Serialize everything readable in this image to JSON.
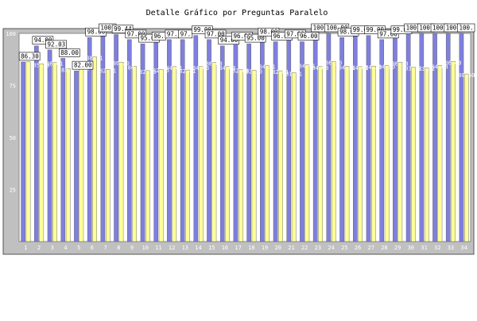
{
  "chart_data": {
    "type": "bar",
    "title": "Detalle Gráfico por Preguntas Paralelo",
    "ylim": [
      0,
      100
    ],
    "y_ticks": [
      "25",
      "50",
      "75",
      "100"
    ],
    "grid": false,
    "legend": "none",
    "categories": [
      "1",
      "2",
      "3",
      "4",
      "5",
      "6",
      "7",
      "8",
      "9",
      "10",
      "11",
      "12",
      "13",
      "14",
      "15",
      "16",
      "17",
      "18",
      "19",
      "20",
      "21",
      "22",
      "23",
      "24",
      "25",
      "26",
      "27",
      "28",
      "29",
      "30",
      "31",
      "32",
      "33",
      "34"
    ],
    "series": [
      {
        "color": "#7f7fdf",
        "values": [
          86.3,
          94,
          92.03,
          88,
          82,
          98,
          100,
          99.44,
          97,
          95,
          96,
          97,
          97,
          99,
          97,
          94,
          96,
          95,
          98,
          96,
          97,
          96,
          100,
          100,
          98,
          99,
          99,
          97,
          99,
          100,
          100,
          100,
          100,
          100
        ],
        "labels": [
          "86.30",
          "94.00",
          "92.03",
          "88.00",
          "82.00",
          "98.00",
          "100.",
          "99.44",
          "97.00",
          "95.00",
          "96.",
          "97.",
          "97.",
          "99.00",
          "97.00",
          "94.00",
          "96.00",
          "95.00",
          "98.00",
          "96.00",
          "97.00",
          "96.00",
          "100.",
          "100.00",
          "98.00",
          "99.0",
          "99.00",
          "97.00",
          "99.00",
          "100.",
          "100.",
          "100.",
          "100.",
          "100."
        ]
      },
      {
        "color": "#ffff99",
        "values": [
          86.3,
          85.36,
          86.01,
          83.1,
          83.82,
          88.71,
          82.71,
          86.2,
          84.1,
          82.1,
          82.75,
          84.01,
          82.41,
          84.03,
          86.03,
          84.03,
          82.68,
          82.3,
          84.51,
          82.01,
          81.11,
          84.91,
          84.03,
          86.5,
          84.21,
          84.01,
          84.3,
          84.5,
          86.13,
          83.72,
          83.52,
          84.63,
          86.48,
          80.5
        ],
        "labels": [
          "",
          "85.36",
          "86.01",
          "83.1",
          "83.82",
          "88.71",
          "82.71",
          "86.20",
          "84.1",
          "82.10",
          "82.75",
          "84.01",
          "82.41",
          "84.03",
          "86.03",
          "84.03",
          "82.68",
          "82.30",
          "84.51",
          "82.01",
          "81.11",
          "84.91",
          "84.03",
          "86.50",
          "84.21",
          "84.01",
          "84.30",
          "84.50",
          "86.13",
          "83.72",
          "83.52",
          "84.63",
          "86.48",
          "80.50"
        ]
      }
    ],
    "colors": {
      "outer_background": "#c0c0c0",
      "plot_background": "#ffffff",
      "border": "#555555",
      "label_box": "#ffffff",
      "text": "#000000"
    }
  }
}
